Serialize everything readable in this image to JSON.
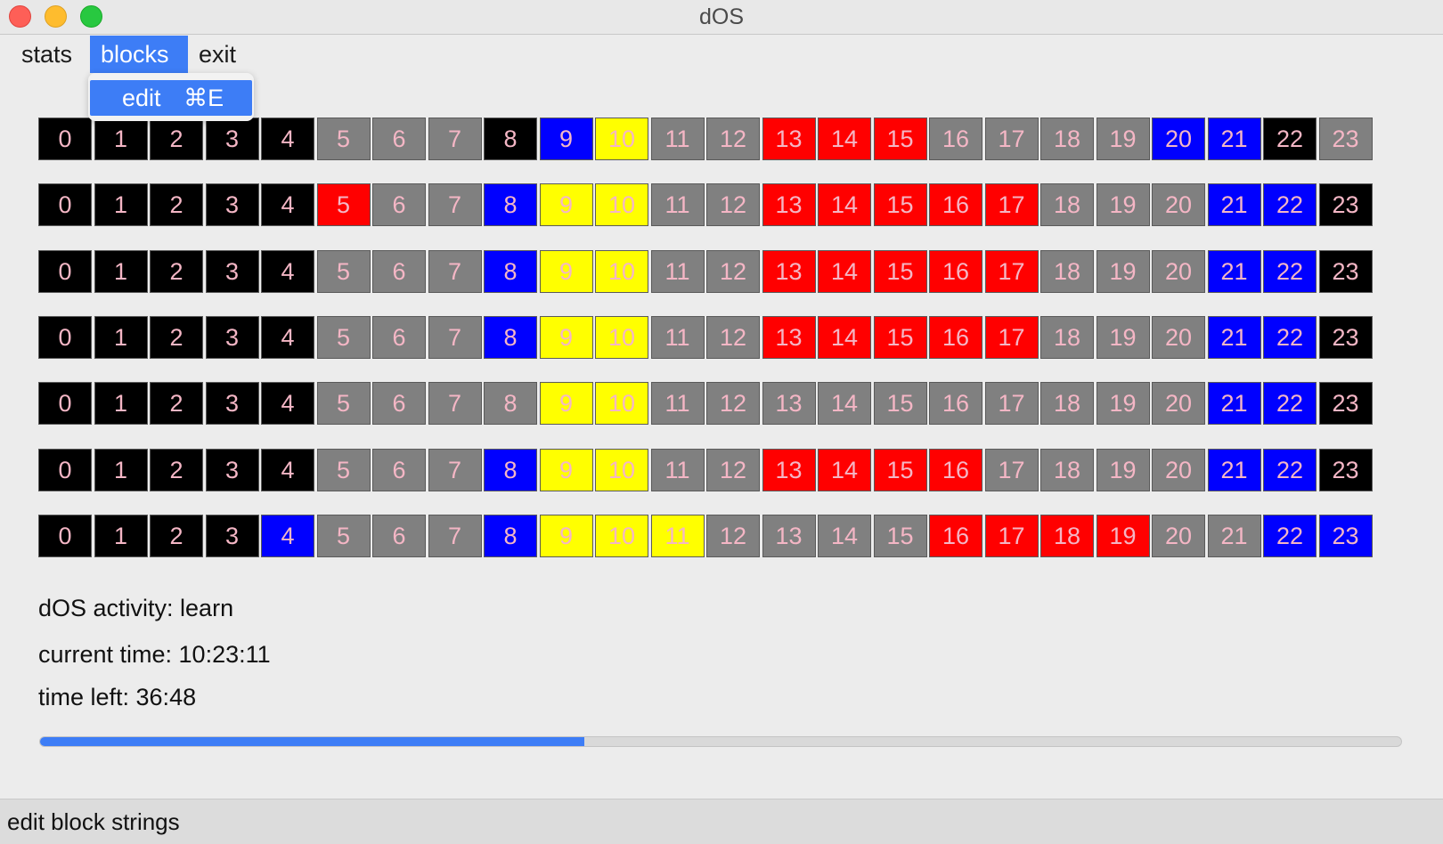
{
  "window": {
    "title": "dOS"
  },
  "menubar": {
    "items": [
      "stats",
      "blocks",
      "exit"
    ]
  },
  "dropdown": {
    "item_label": "edit",
    "item_shortcut": "⌘E"
  },
  "palette": {
    "k": "#000000",
    "g": "#808080",
    "r": "#ff0000",
    "b": "#0000ff",
    "y": "#ffff00",
    "label_color": "#f4b6c5"
  },
  "blocks": {
    "labels": [
      "0",
      "1",
      "2",
      "3",
      "4",
      "5",
      "6",
      "7",
      "8",
      "9",
      "10",
      "11",
      "12",
      "13",
      "14",
      "15",
      "16",
      "17",
      "18",
      "19",
      "20",
      "21",
      "22",
      "23"
    ],
    "rows": [
      "kkkkkgggkbyggrrrggggbbk",
      "kkkkkrggbyyggrrrrrgggbbk",
      "kkkkkgggbyyggrrrrrgggbbk",
      "kkkkkgggbyyggrrrrrgggbbk",
      "kkkkkggggyyggggggggggbbk",
      "kkkkkgggbyyggrrrrggggbbk",
      "kkkkbgggbyyyggggrrrrggbbk"
    ]
  },
  "status": {
    "activity": "dOS activity: learn",
    "current_time": "current time: 10:23:11",
    "time_left": "time left: 36:48"
  },
  "progress": {
    "fraction": 0.4
  },
  "statusbar": {
    "text": "edit block strings"
  }
}
